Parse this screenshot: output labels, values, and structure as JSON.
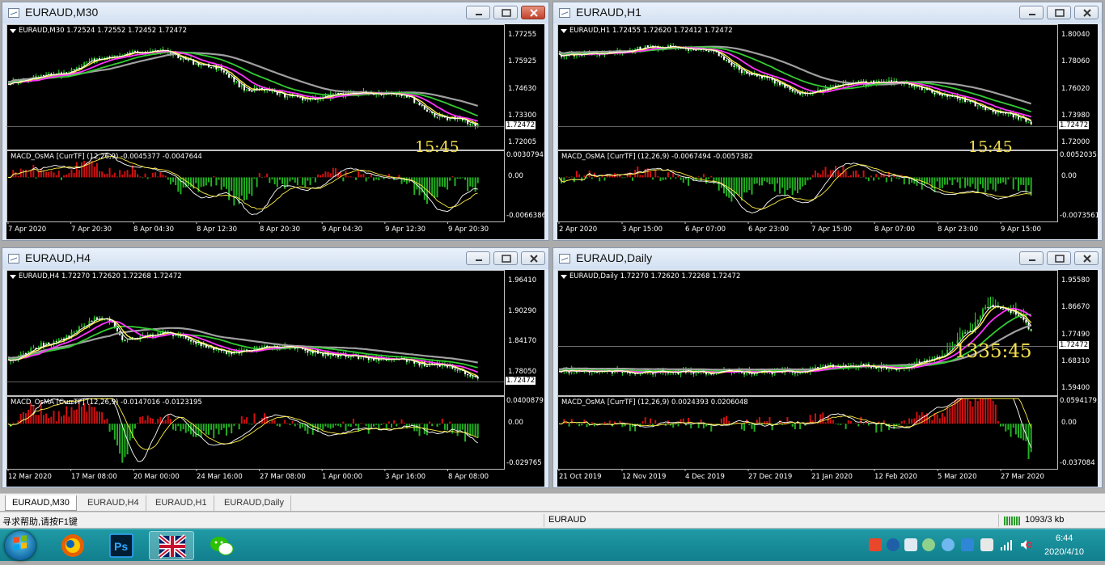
{
  "windows": [
    {
      "id": "m30",
      "title": "EURAUD,M30",
      "ohlc": "EURAUD,M30  1.72524 1.72552 1.72452 1.72472",
      "countdown": "15:45",
      "prices": [
        "1.77255",
        "1.75925",
        "1.74630",
        "1.73300",
        "1.72005"
      ],
      "current_price": "1.72472",
      "macd_label": "MACD_OsMA [CurrTF] (12,26,9) -0.0045377 -0.0047644",
      "macd_scale": [
        "0.0030794",
        "0.00",
        "-0.0066386"
      ],
      "time_labels": [
        "7 Apr 2020",
        "7 Apr 20:30",
        "8 Apr 04:30",
        "8 Apr 12:30",
        "8 Apr 20:30",
        "9 Apr 04:30",
        "9 Apr 12:30",
        "9 Apr 20:30"
      ]
    },
    {
      "id": "h1",
      "title": "EURAUD,H1",
      "ohlc": "EURAUD,H1  1.72455 1.72620 1.72412 1.72472",
      "countdown": "15:45",
      "prices": [
        "1.80040",
        "1.78060",
        "1.76020",
        "1.73980",
        "1.72000"
      ],
      "current_price": "1.72472",
      "macd_label": "MACD_OsMA [CurrTF] (12,26,9) -0.0067494 -0.0057382",
      "macd_scale": [
        "0.0052035",
        "0.00",
        "-0.0073561"
      ],
      "time_labels": [
        "2 Apr 2020",
        "3 Apr 15:00",
        "6 Apr 07:00",
        "6 Apr 23:00",
        "7 Apr 15:00",
        "8 Apr 07:00",
        "8 Apr 23:00",
        "9 Apr 15:00"
      ]
    },
    {
      "id": "h4",
      "title": "EURAUD,H4",
      "ohlc": "EURAUD,H4  1.72270 1.72620 1.72268 1.72472",
      "countdown": "",
      "prices": [
        "1.96410",
        "1.90290",
        "1.84170",
        "1.78050"
      ],
      "current_price": "1.72472",
      "macd_label": "MACD_OsMA [CurrTF] (12,26,9) -0.0147016 -0.0123195",
      "macd_scale": [
        "0.0400879",
        "0.00",
        "-0.029765"
      ],
      "time_labels": [
        "12 Mar 2020",
        "17 Mar 08:00",
        "20 Mar 00:00",
        "24 Mar 16:00",
        "27 Mar 08:00",
        "1 Apr 00:00",
        "3 Apr 16:00",
        "8 Apr 08:00"
      ]
    },
    {
      "id": "daily",
      "title": "EURAUD,Daily",
      "ohlc": "EURAUD,Daily  1.72270 1.72620 1.72268 1.72472",
      "countdown": "1335:45",
      "prices": [
        "1.95580",
        "1.86670",
        "1.77490",
        "1.68310",
        "1.59400"
      ],
      "current_price": "1.72472",
      "macd_label": "MACD_OsMA [CurrTF] (12,26,9) 0.0024393 0.0206048",
      "macd_scale": [
        "0.0594179",
        "0.00",
        "-0.037084"
      ],
      "time_labels": [
        "21 Oct 2019",
        "12 Nov 2019",
        "4 Dec 2019",
        "27 Dec 2019",
        "21 Jan 2020",
        "12 Feb 2020",
        "5 Mar 2020",
        "27 Mar 2020"
      ]
    }
  ],
  "tabs": [
    "EURAUD,M30",
    "EURAUD,H4",
    "EURAUD,H1",
    "EURAUD,Daily"
  ],
  "status": {
    "help": "寻求帮助,请按F1键",
    "symbol": "EURAUD",
    "connection": "1093/3 kb"
  },
  "clock": {
    "time": "6:44",
    "date": "2020/4/10"
  },
  "taskbar_apps": [
    "start-orb",
    "firefox",
    "photoshop",
    "metatrader",
    "wechat"
  ]
}
